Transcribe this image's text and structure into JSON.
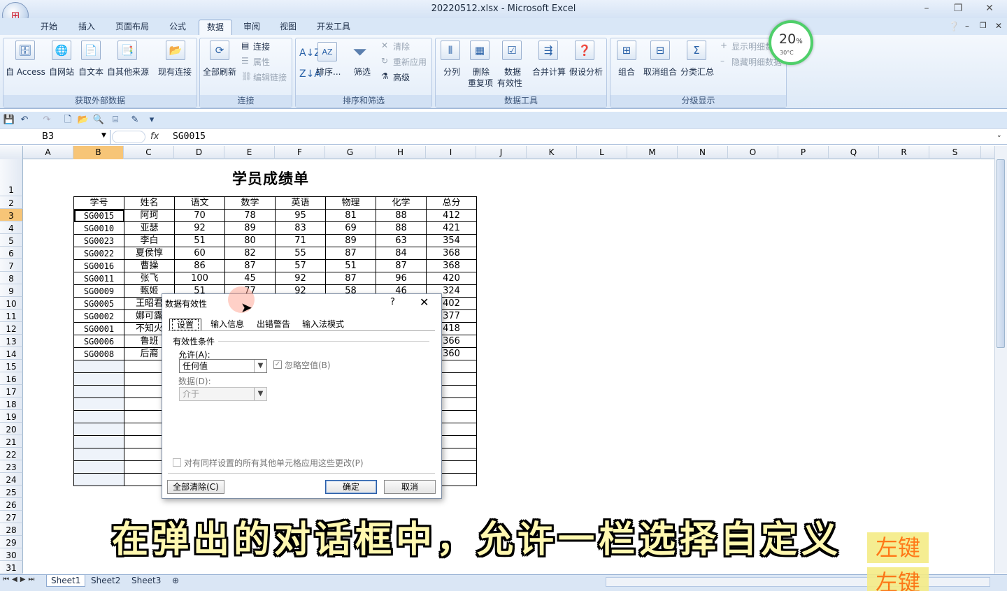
{
  "window": {
    "title": "20220512.xlsx - Microsoft Excel",
    "minimize": "–",
    "restore": "❐",
    "close": "✕"
  },
  "ribbon": {
    "tabs": [
      "开始",
      "插入",
      "页面布局",
      "公式",
      "数据",
      "审阅",
      "视图",
      "开发工具"
    ],
    "active_tab": "数据",
    "groups": {
      "external": {
        "label": "获取外部数据",
        "buttons": [
          "自 Access",
          "自网站",
          "自文本",
          "自其他来源",
          "现有连接"
        ]
      },
      "connections": {
        "label": "连接",
        "refresh_all": "全部刷新",
        "connections": "连接",
        "properties": "属性",
        "edit_links": "编辑链接"
      },
      "sortfilter": {
        "label": "排序和筛选",
        "sort": "排序...",
        "filter": "筛选",
        "clear": "清除",
        "reapply": "重新应用",
        "advanced": "高级"
      },
      "datatools": {
        "label": "数据工具",
        "split": "分列",
        "remove_dup_1": "删除",
        "remove_dup_2": "重复项",
        "validation_1": "数据",
        "validation_2": "有效性",
        "consolidate": "合并计算",
        "whatif": "假设分析"
      },
      "outline": {
        "label": "分级显示",
        "group": "组合",
        "ungroup": "取消组合",
        "subtotal": "分类汇总",
        "show_detail": "显示明细数据",
        "hide_detail": "隐藏明细数据"
      }
    }
  },
  "formula_bar": {
    "name_box": "B3",
    "fx": "fx",
    "value": "SG0015"
  },
  "columns": [
    "A",
    "B",
    "C",
    "D",
    "E",
    "F",
    "G",
    "H",
    "I",
    "J",
    "K",
    "L",
    "M",
    "N",
    "O",
    "P",
    "Q",
    "R",
    "S"
  ],
  "selected_column": "B",
  "rows": [
    "1",
    "2",
    "3",
    "4",
    "5",
    "6",
    "7",
    "8",
    "9",
    "10",
    "11",
    "12",
    "13",
    "14",
    "15",
    "16",
    "17",
    "18",
    "19",
    "20",
    "21",
    "22",
    "23",
    "24",
    "25",
    "26",
    "27",
    "28",
    "29",
    "30",
    "31"
  ],
  "sheet": {
    "title": "学员成绩单",
    "headers": [
      "学号",
      "姓名",
      "语文",
      "数学",
      "英语",
      "物理",
      "化学",
      "总分"
    ],
    "rows": [
      [
        "SG0015",
        "阿珂",
        "70",
        "78",
        "95",
        "81",
        "88",
        "412"
      ],
      [
        "SG0010",
        "亚瑟",
        "92",
        "89",
        "83",
        "69",
        "88",
        "421"
      ],
      [
        "SG0023",
        "李白",
        "51",
        "80",
        "71",
        "89",
        "63",
        "354"
      ],
      [
        "SG0022",
        "夏侯惇",
        "60",
        "82",
        "55",
        "87",
        "84",
        "368"
      ],
      [
        "SG0016",
        "曹操",
        "86",
        "87",
        "57",
        "51",
        "87",
        "368"
      ],
      [
        "SG0011",
        "张飞",
        "100",
        "45",
        "92",
        "87",
        "96",
        "420"
      ],
      [
        "SG0009",
        "甄姬",
        "51",
        "77",
        "92",
        "58",
        "46",
        "324"
      ],
      [
        "SG0005",
        "王昭君",
        "",
        "",
        "",
        "",
        "",
        "402"
      ],
      [
        "SG0002",
        "娜可露",
        "",
        "",
        "",
        "",
        "",
        "377"
      ],
      [
        "SG0001",
        "不知火",
        "",
        "",
        "",
        "",
        "",
        "418"
      ],
      [
        "SG0006",
        "鲁班",
        "",
        "",
        "",
        "",
        "",
        "366"
      ],
      [
        "SG0008",
        "后裔",
        "",
        "",
        "",
        "",
        "",
        "360"
      ]
    ]
  },
  "sheet_tabs": [
    "Sheet1",
    "Sheet2",
    "Sheet3"
  ],
  "dialog": {
    "title": "数据有效性",
    "help": "?",
    "close": "✕",
    "tabs": [
      "设置",
      "输入信息",
      "出错警告",
      "输入法模式"
    ],
    "section": "有效性条件",
    "allow_label": "允许(A):",
    "allow_value": "任何值",
    "ignore_blank": "忽略空值(B)",
    "data_label": "数据(D):",
    "data_value": "介于",
    "apply_all": "对有同样设置的所有其他单元格应用这些更改(P)",
    "clear_all": "全部清除(C)",
    "ok": "确定",
    "cancel": "取消"
  },
  "overlay": {
    "subtitle": "在弹出的对话框中，允许一栏选择自定义",
    "key_badge_1": "左键",
    "key_badge_2": "左键",
    "gauge_percent": "20",
    "gauge_percent_unit": "%",
    "gauge_temp": "30°C"
  }
}
